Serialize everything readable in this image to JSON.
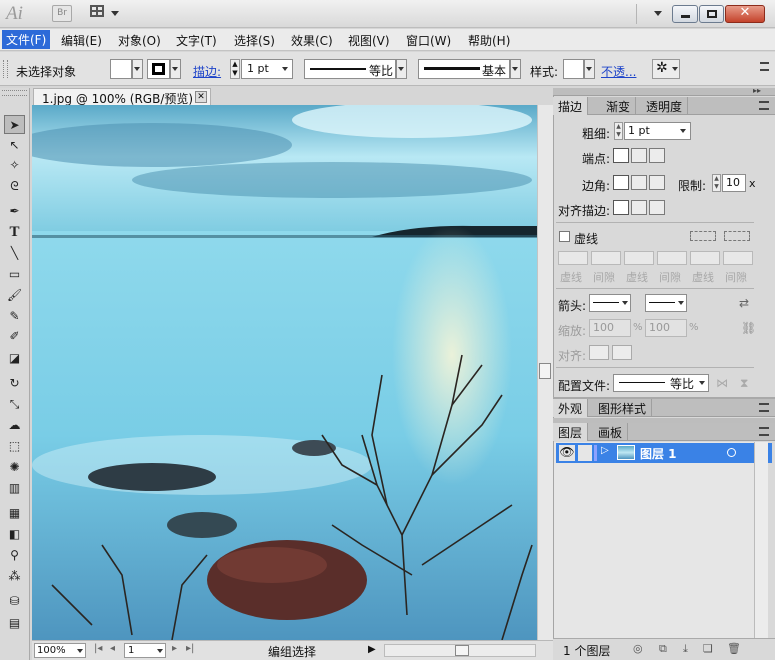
{
  "app": {
    "logo": "Ai",
    "bridge": "Br"
  },
  "menu": [
    "文件(F)",
    "编辑(E)",
    "对象(O)",
    "文字(T)",
    "选择(S)",
    "效果(C)",
    "视图(V)",
    "窗口(W)",
    "帮助(H)"
  ],
  "control": {
    "selection_status": "未选择对象",
    "stroke_label": "描边:",
    "stroke_weight": "1 pt",
    "profile_label": "等比",
    "brush_label": "基本",
    "style_label": "样式:",
    "opacity_label": "不透..."
  },
  "document": {
    "tab_label": "1.jpg @ 100% (RGB/预览)"
  },
  "status": {
    "zoom": "100%",
    "artboard": "1",
    "info": "编组选择"
  },
  "stroke_panel": {
    "tabs": [
      "描边",
      "渐变",
      "透明度"
    ],
    "weight_label": "粗细:",
    "weight_value": "1 pt",
    "cap_label": "端点:",
    "corner_label": "边角:",
    "limit_label": "限制:",
    "limit_value": "10",
    "limit_unit": "x",
    "align_label": "对齐描边:",
    "dashed_label": "虚线",
    "dash_labels": [
      "虚线",
      "间隙",
      "虚线",
      "间隙",
      "虚线",
      "间隙"
    ],
    "arrow_label": "箭头:",
    "scale_label": "缩放:",
    "scale_start": "100",
    "scale_end": "100",
    "percent": "%",
    "align_arrow_label": "对齐:",
    "profile_label": "配置文件:",
    "profile_value": "等比"
  },
  "appearance_panel": {
    "tabs": [
      "外观",
      "图形样式"
    ]
  },
  "layers_panel": {
    "tabs": [
      "图层",
      "画板"
    ],
    "layer_name": "图层 1",
    "footer": "1 个图层"
  },
  "colors": {
    "selection_blue": "#3a82e6",
    "menu_active": "#2d6ad8",
    "link_blue": "#1e44c9"
  },
  "icons": [
    "selection-tool",
    "direct-selection-tool",
    "magic-wand-tool",
    "lasso-tool",
    "pen-tool",
    "type-tool",
    "line-tool",
    "rectangle-tool",
    "paintbrush-tool",
    "pencil-tool",
    "blob-brush-tool",
    "eraser-tool",
    "rotate-tool",
    "scale-tool",
    "warp-tool",
    "free-transform-tool",
    "symbol-sprayer-tool",
    "graph-tool",
    "mesh-tool",
    "gradient-tool",
    "eyedropper-tool",
    "blend-tool",
    "live-paint-tool",
    "slice-tool"
  ]
}
